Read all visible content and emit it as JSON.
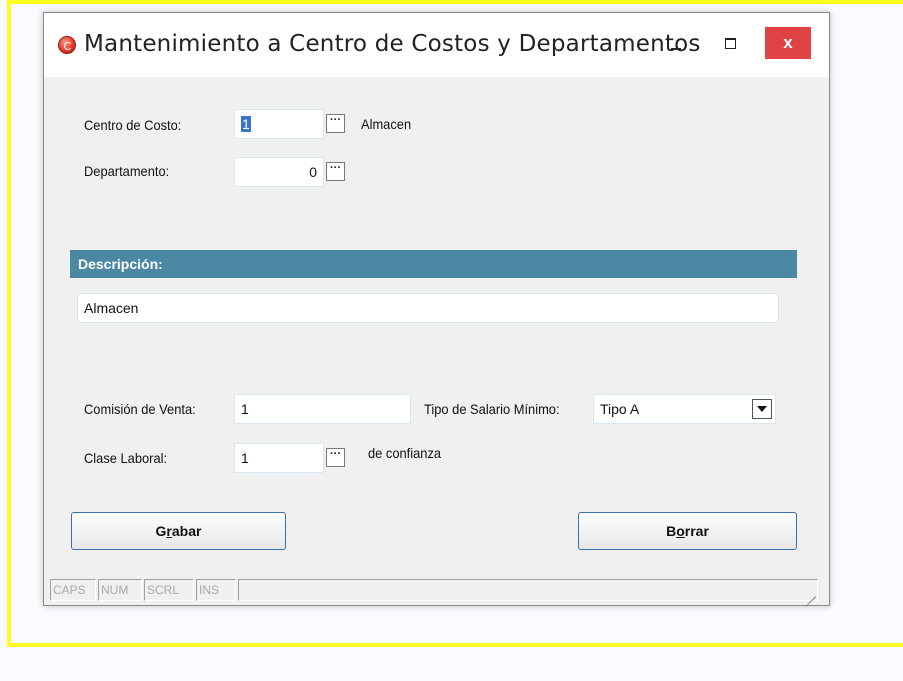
{
  "window": {
    "title": "Mantenimiento a Centro de Costos y Departamentos",
    "close_glyph": "x"
  },
  "form": {
    "centro_label": "Centro de Costo:",
    "centro_value": "1",
    "centro_desc": "Almacen",
    "departamento_label": "Departamento:",
    "departamento_value": "0",
    "lookup_glyph": "···",
    "descripcion_header": "Descripción:",
    "descripcion_value": "Almacen",
    "comision_label": "Comisión de Venta:",
    "comision_value": "1",
    "tipo_salario_label": "Tipo de Salario Mínimo:",
    "tipo_salario_value": "Tipo A",
    "clase_label": "Clase Laboral:",
    "clase_value": "1",
    "clase_desc": "de confianza"
  },
  "buttons": {
    "grabar_pre": "G",
    "grabar_u": "r",
    "grabar_post": "abar",
    "borrar_pre": "B",
    "borrar_u": "o",
    "borrar_post": "rrar"
  },
  "statusbar": {
    "cells": [
      "CAPS",
      "NUM",
      "SCRL",
      "INS"
    ]
  },
  "colors": {
    "highlight_frame": "#ffff1f",
    "section_bar": "#4a88a4",
    "close_button": "#e04343",
    "button_border": "#3c6fa8"
  }
}
